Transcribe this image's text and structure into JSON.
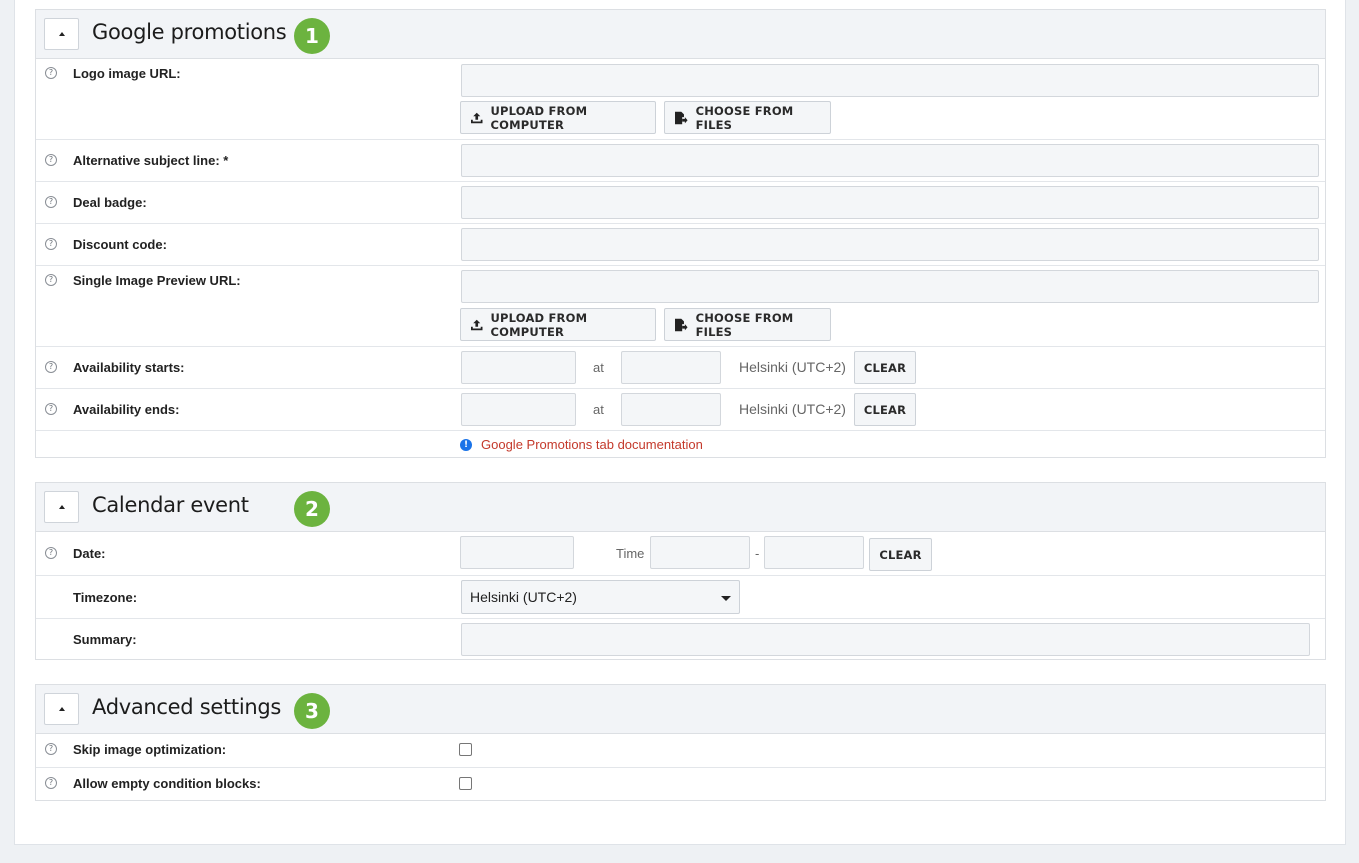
{
  "sections": {
    "google_promotions": {
      "title": "Google promotions",
      "badge": "1",
      "logo_image_url": {
        "label": "Logo image URL:",
        "value": ""
      },
      "upload_label": "UPLOAD FROM COMPUTER",
      "choose_label": "CHOOSE FROM FILES",
      "alt_subject": {
        "label": "Alternative subject line: *",
        "value": ""
      },
      "deal_badge": {
        "label": "Deal badge:",
        "value": ""
      },
      "discount_code": {
        "label": "Discount code:",
        "value": ""
      },
      "single_image_preview": {
        "label": "Single Image Preview URL:",
        "value": ""
      },
      "availability_starts": {
        "label": "Availability starts:",
        "at": "at",
        "timezone": "Helsinki (UTC+2)",
        "clear": "CLEAR"
      },
      "availability_ends": {
        "label": "Availability ends:",
        "at": "at",
        "timezone": "Helsinki (UTC+2)",
        "clear": "CLEAR"
      },
      "doc_link": "Google Promotions tab documentation"
    },
    "calendar_event": {
      "title": "Calendar event",
      "badge": "2",
      "date": {
        "label": "Date:",
        "time_label": "Time",
        "dash": "-",
        "clear": "CLEAR"
      },
      "timezone": {
        "label": "Timezone:",
        "selected": "Helsinki (UTC+2)"
      },
      "summary": {
        "label": "Summary:",
        "value": ""
      }
    },
    "advanced_settings": {
      "title": "Advanced settings",
      "badge": "3",
      "skip_image_optimization": {
        "label": "Skip image optimization:",
        "checked": false
      },
      "allow_empty_condition_blocks": {
        "label": "Allow empty condition blocks:",
        "checked": false
      }
    }
  },
  "icons": {
    "help": "question-circle-icon",
    "upload": "upload-icon",
    "choose": "file-arrow-icon",
    "info": "info-circle-icon",
    "collapse": "caret-up-icon"
  },
  "colors": {
    "badge": "#6cb33f",
    "doc_link": "#c4392b",
    "info_icon": "#1a73e8",
    "header_bg": "#f2f4f7",
    "input_bg": "#f4f6f8"
  }
}
